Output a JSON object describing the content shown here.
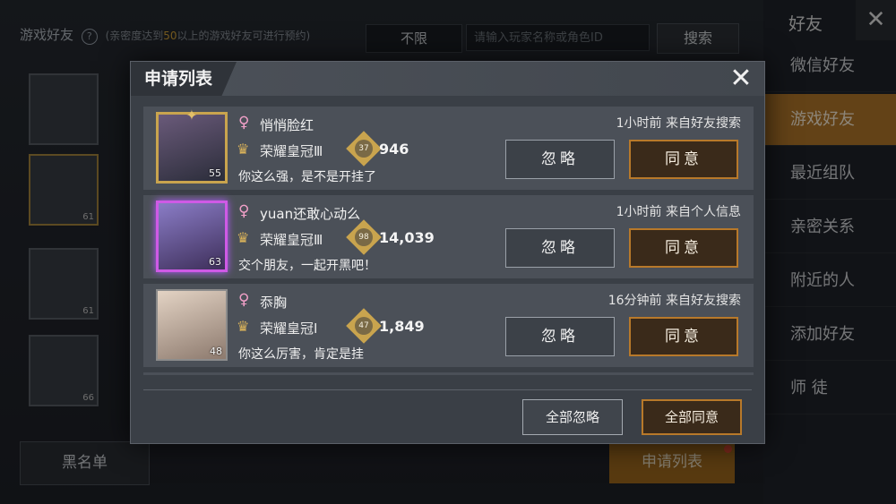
{
  "background": {
    "section_title": "游戏好友",
    "help_glyph": "?",
    "hint_prefix": "(亲密度达到",
    "hint_number": "50",
    "hint_suffix": "以上的游戏好友可进行预约)",
    "filter_value": "不限",
    "search_placeholder": "请输入玩家名称或角色ID",
    "search_button": "搜索",
    "friend_levels": [
      "61",
      "61",
      "66"
    ],
    "blacklist_button": "黑名单",
    "apply_list_button": "申请列表"
  },
  "side_panel": {
    "title": "好友",
    "close_glyph": "✕",
    "items": [
      {
        "label": "微信好友",
        "active": false
      },
      {
        "label": "游戏好友",
        "active": true
      },
      {
        "label": "最近组队",
        "active": false
      },
      {
        "label": "亲密关系",
        "active": false
      },
      {
        "label": "附近的人",
        "active": false
      },
      {
        "label": "添加好友",
        "active": false
      },
      {
        "label": "师 徒",
        "active": false
      }
    ]
  },
  "modal": {
    "title": "申请列表",
    "close_glyph": "✕",
    "requests": [
      {
        "gender_glyph": "♀",
        "name": "悄悄脸红",
        "level": "55",
        "tier": "荣耀皇冠Ⅲ",
        "star_badge": "37",
        "points": "946",
        "message": "你这么强，是不是开挂了",
        "meta": "1小时前 来自好友搜索",
        "ignore_label": "忽略",
        "agree_label": "同意"
      },
      {
        "gender_glyph": "♀",
        "name": "yuan还敢心动么",
        "level": "63",
        "tier": "荣耀皇冠Ⅲ",
        "star_badge": "98",
        "points": "14,039",
        "message": "交个朋友，一起开黑吧！",
        "meta": "1小时前 来自个人信息",
        "ignore_label": "忽略",
        "agree_label": "同意"
      },
      {
        "gender_glyph": "♀",
        "name": "忝胸",
        "level": "48",
        "tier": "荣耀皇冠Ⅰ",
        "star_badge": "47",
        "points": "1,849",
        "message": "你这么厉害，肯定是挂",
        "meta": "16分钟前 来自好友搜索",
        "ignore_label": "忽略",
        "agree_label": "同意"
      }
    ],
    "ignore_all_label": "全部忽略",
    "agree_all_label": "全部同意"
  },
  "colors": {
    "accent": "#b5782a",
    "agree_border": "#b8792a",
    "female": "#f1a0c8",
    "gold": "#c9a44e"
  }
}
